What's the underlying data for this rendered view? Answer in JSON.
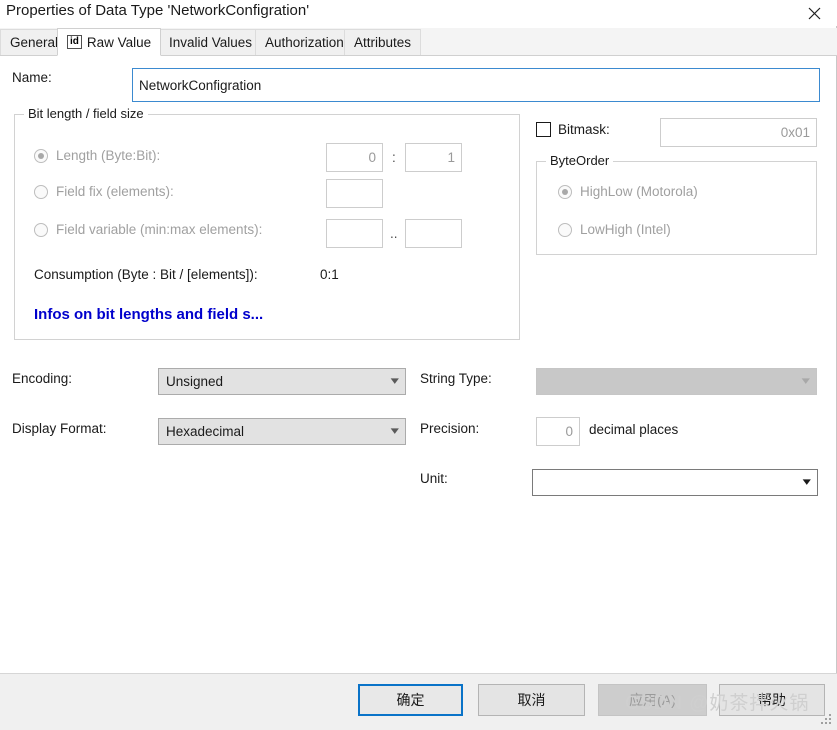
{
  "window": {
    "title": "Properties of Data Type 'NetworkConfigration'",
    "close_icon": "close-icon"
  },
  "tabs": [
    {
      "label": "General",
      "active": false,
      "icon": ""
    },
    {
      "label": "Raw Value",
      "active": true,
      "icon": "id"
    },
    {
      "label": "Invalid Values",
      "active": false,
      "icon": ""
    },
    {
      "label": "Authorization",
      "active": false,
      "icon": ""
    },
    {
      "label": "Attributes",
      "active": false,
      "icon": ""
    }
  ],
  "name_field": {
    "label": "Name:",
    "value": "NetworkConfigration",
    "placeholder": ""
  },
  "bit_length_group": {
    "title": "Bit length / field size",
    "length_radio_label": "Length (Byte:Bit):",
    "length_byte_value": "0",
    "length_separator": ":",
    "length_bit_value": "1",
    "field_fix_radio_label": "Field fix (elements):",
    "field_fix_value": "",
    "field_variable_radio_label": "Field variable (min:max elements):",
    "field_variable_min": "",
    "field_variable_separator": "..",
    "field_variable_max": "",
    "consumption_label": "Consumption (Byte : Bit / [elements]):",
    "consumption_value": "0:1",
    "info_link": "Infos on bit lengths and field s..."
  },
  "bitmask": {
    "label": "Bitmask:",
    "checked": false,
    "value": "0x01"
  },
  "byte_order_group": {
    "title": "ByteOrder",
    "options": [
      {
        "label": "HighLow (Motorola)",
        "selected": true
      },
      {
        "label": "LowHigh (Intel)",
        "selected": false
      }
    ]
  },
  "encoding": {
    "label": "Encoding:",
    "value": "Unsigned"
  },
  "display_format": {
    "label": "Display Format:",
    "value": "Hexadecimal"
  },
  "string_type": {
    "label": "String Type:",
    "value": ""
  },
  "precision": {
    "label": "Precision:",
    "value": "0",
    "suffix": "decimal places"
  },
  "unit": {
    "label": "Unit:",
    "value": ""
  },
  "footer": {
    "ok_label": "确定",
    "cancel_label": "取消",
    "apply_label": "应用(A)",
    "help_label": "帮助"
  },
  "watermark": {
    "text": "CSDN @奶茶拌火锅"
  },
  "colors": {
    "accent": "#0a73c8",
    "link": "#0000cc",
    "disabled_text": "#a0a0a0",
    "footer_bg": "#f0f0f0"
  }
}
